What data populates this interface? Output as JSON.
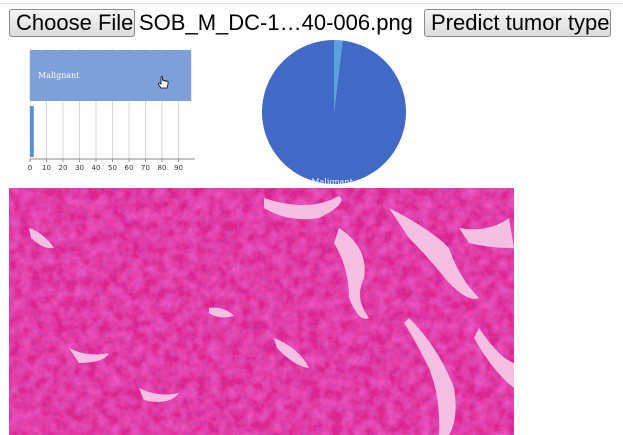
{
  "controls": {
    "choose_file_label": "Choose File",
    "file_name": "SOB_M_DC-1…40-006.png",
    "predict_label": "Predict tumor type"
  },
  "colors": {
    "bar_primary": "#7f9fd9",
    "bar_secondary": "#5a8fd8",
    "pie_primary": "#4169c6",
    "pie_secondary": "#5aa2dd",
    "tissue_base": "#e0208e",
    "tissue_dark": "#7a1a8e",
    "tissue_light": "#f6c6e6"
  },
  "icons": {
    "cursor": "hand-pointer-icon"
  },
  "chart_data": [
    {
      "type": "bar",
      "orientation": "horizontal",
      "categories": [
        "Malignant",
        ""
      ],
      "values": [
        97.7,
        2.3
      ],
      "ticks": [
        "0",
        "10",
        "20",
        "30",
        "40",
        "50",
        "60",
        "70",
        "80",
        "90"
      ],
      "xlim": [
        0,
        100
      ],
      "grid": true,
      "title": "",
      "xlabel": "",
      "ylabel": ""
    },
    {
      "type": "pie",
      "labels": [
        "Malignant",
        ""
      ],
      "values": [
        98.1,
        1.9
      ]
    }
  ],
  "image": {
    "description": "H&E stained breast tissue histopathology image"
  }
}
